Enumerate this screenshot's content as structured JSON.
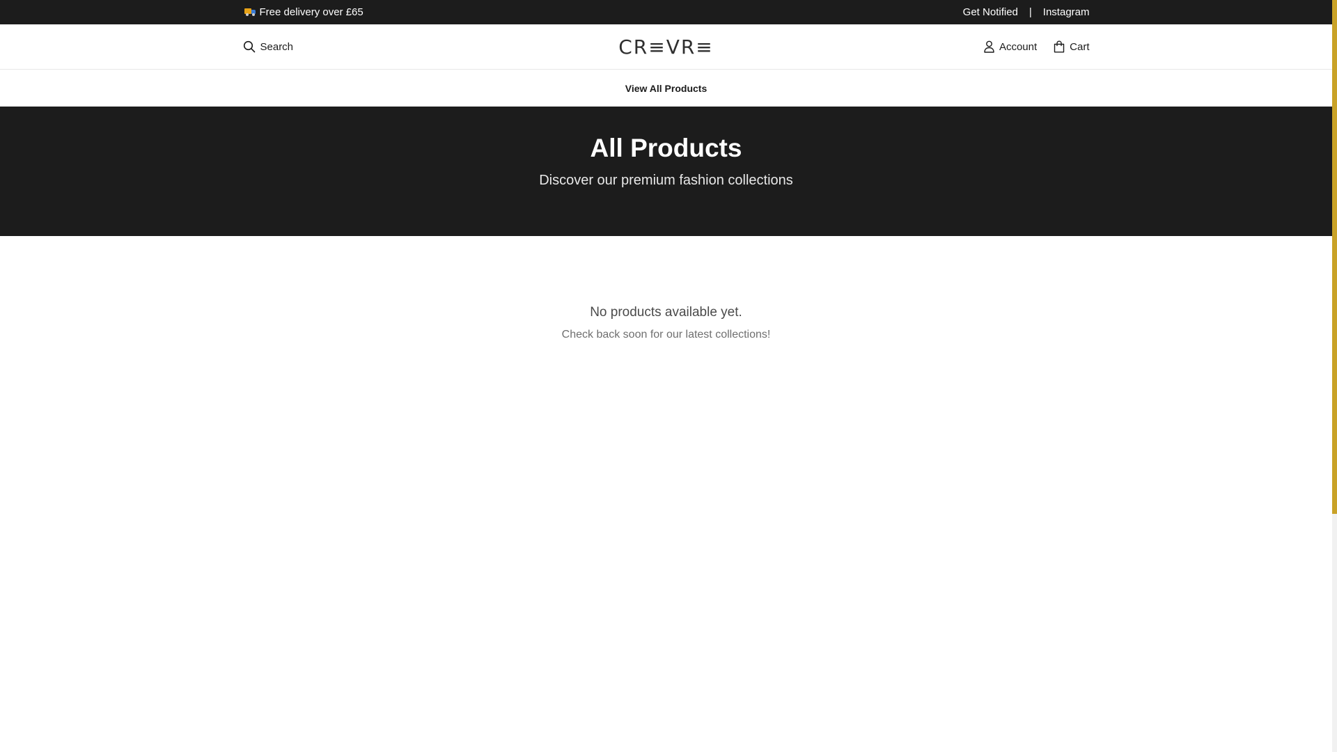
{
  "announcement": {
    "promo_text": "Free delivery over £65",
    "promo_icon": "delivery-truck-icon",
    "links": [
      "Get Notified",
      "Instagram"
    ],
    "separator": "|"
  },
  "header": {
    "search_label": "Search",
    "logo": "CR≡VR≡",
    "account_label": "Account",
    "cart_label": "Cart"
  },
  "nav": {
    "items": [
      "View All Products"
    ]
  },
  "hero": {
    "title": "All Products",
    "subtitle": "Discover our premium fashion collections"
  },
  "empty_state": {
    "message": "No products available yet.",
    "submessage": "Check back soon for our latest collections!"
  },
  "colors": {
    "dark": "#1c1c1c",
    "scrollbar_accent": "#c9a227"
  }
}
